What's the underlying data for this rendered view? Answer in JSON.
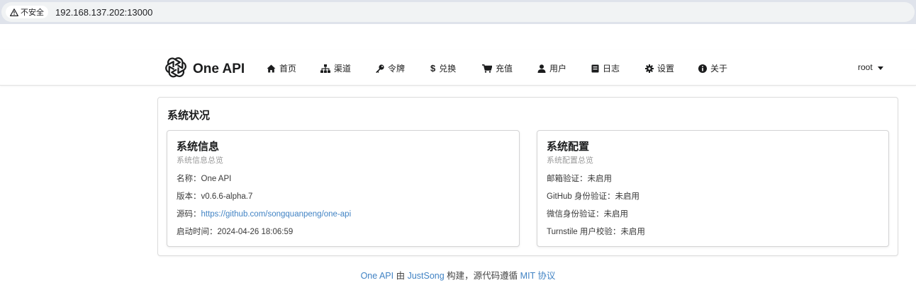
{
  "browser": {
    "security_label": "不安全",
    "url": "192.168.137.202:13000"
  },
  "nav": {
    "brand": "One API",
    "items": [
      {
        "label": "首页",
        "icon": "home-icon"
      },
      {
        "label": "渠道",
        "icon": "sitemap-icon"
      },
      {
        "label": "令牌",
        "icon": "key-icon"
      },
      {
        "label": "兑换",
        "icon": "dollar-icon"
      },
      {
        "label": "充值",
        "icon": "cart-icon"
      },
      {
        "label": "用户",
        "icon": "user-icon"
      },
      {
        "label": "日志",
        "icon": "book-icon"
      },
      {
        "label": "设置",
        "icon": "gear-icon"
      },
      {
        "label": "关于",
        "icon": "info-icon"
      }
    ],
    "user": "root"
  },
  "status": {
    "title": "系统状况",
    "info": {
      "title": "系统信息",
      "meta": "系统信息总览",
      "name_label": "名称：",
      "name_value": "One API",
      "version_label": "版本：",
      "version_value": "v0.6.6-alpha.7",
      "source_label": "源码：",
      "source_value": "https://github.com/songquanpeng/one-api",
      "started_label": "启动时间：",
      "started_value": "2024-04-26 18:06:59"
    },
    "config": {
      "title": "系统配置",
      "meta": "系统配置总览",
      "rows": [
        "邮箱验证：未启用",
        "GitHub 身份验证：未启用",
        "微信身份验证：未启用",
        "Turnstile 用户校验：未启用"
      ]
    }
  },
  "footer": {
    "project": "One API",
    "by": " 由 ",
    "author": "JustSong",
    "middle": " 构建，源代码遵循 ",
    "license": "MIT 协议"
  }
}
